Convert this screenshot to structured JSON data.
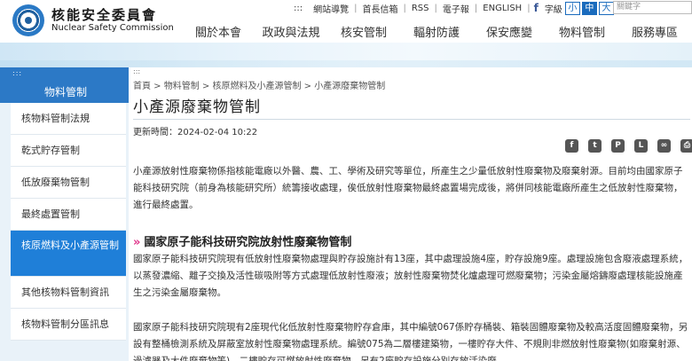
{
  "header": {
    "org_name_zh": "核能安全委員會",
    "org_name_en": "Nuclear Safety Commission",
    "top_links": [
      "網站導覽",
      "首長信箱",
      "RSS",
      "電子報",
      "ENGLISH"
    ],
    "top_dots": ":::",
    "facebook_label": "f",
    "font_size_label": "字級",
    "font_sizes": [
      "小",
      "中",
      "大"
    ],
    "search_placeholder": "關鍵字"
  },
  "nav": [
    "關於本會",
    "政政與法規",
    "核安管制",
    "輻射防護",
    "保安應變",
    "物料管制",
    "服務專區"
  ],
  "sidebar": {
    "dots": ":::",
    "title": "物料管制",
    "items": [
      {
        "label": "核物料管制法規"
      },
      {
        "label": "乾式貯存管制"
      },
      {
        "label": "低放廢棄物管制"
      },
      {
        "label": "最終處置管制"
      },
      {
        "label": "核原燃料及小產源管制"
      },
      {
        "label": "其他核物料管制資訊"
      },
      {
        "label": "核物料管制分區訊息"
      }
    ]
  },
  "main": {
    "dots": ":::",
    "breadcrumb": "首頁 > 物料管制 > 核原燃料及小產源管制 > 小產源廢棄物管制",
    "title": "小產源廢棄物管制",
    "updated": "更新時間：2024-02-04 10:22",
    "share_icons": [
      "facebook-icon",
      "twitter-icon",
      "plurk-icon",
      "line-icon",
      "link-icon",
      "print-icon"
    ],
    "share_glyphs": [
      "f",
      "t",
      "P",
      "L",
      "∞",
      "⎙"
    ],
    "para1": "小產源放射性廢棄物係指核能電廠以外醫、農、工、學術及研究等單位，所產生之少量低放射性廢棄物及廢棄射源。目前均由國家原子能科技研究院（前身為核能研究所）統籌接收處理，俟低放射性廢棄物最終處置場完成後，將併同核能電廠所產生之低放射性廢棄物，進行最終處置。",
    "section_chevron": "»",
    "section_title": "國家原子能科技研究院放射性廢棄物管制",
    "para2": "國家原子能科技研究院現有低放射性廢棄物處理與貯存設施計有13座，其中處理設施4座，貯存設施9座。處理設施包含廢液處理系統，以蒸發濃縮、離子交換及活性碳吸附等方式處理低放射性廢液；放射性廢棄物焚化爐處理可燃廢棄物；污染金屬熔鑄廢處理核能設施產生之污染金屬廢棄物。",
    "para3": "國家原子能科技研究院現有2座現代化低放射性廢棄物貯存倉庫，其中編號067係貯存桶裝、箱裝固體廢棄物及較高活度固體廢棄物，另設有整桶檢測系統及屏蔽室放射性廢棄物處理系統。編號075為二層樓建築物，一樓貯存大件、不規則非燃放射性廢棄物(如廢棄射源、過濾器及大件廢棄物等)，二樓貯存可燃放射性廢棄物，另有2座貯存設施分別存放活染廢"
  },
  "colors": {
    "accent": "#2c79c6",
    "active_item": "#1f7fd8",
    "sidebar_bg": "#e9f2f9",
    "chevron": "#e0358a"
  }
}
